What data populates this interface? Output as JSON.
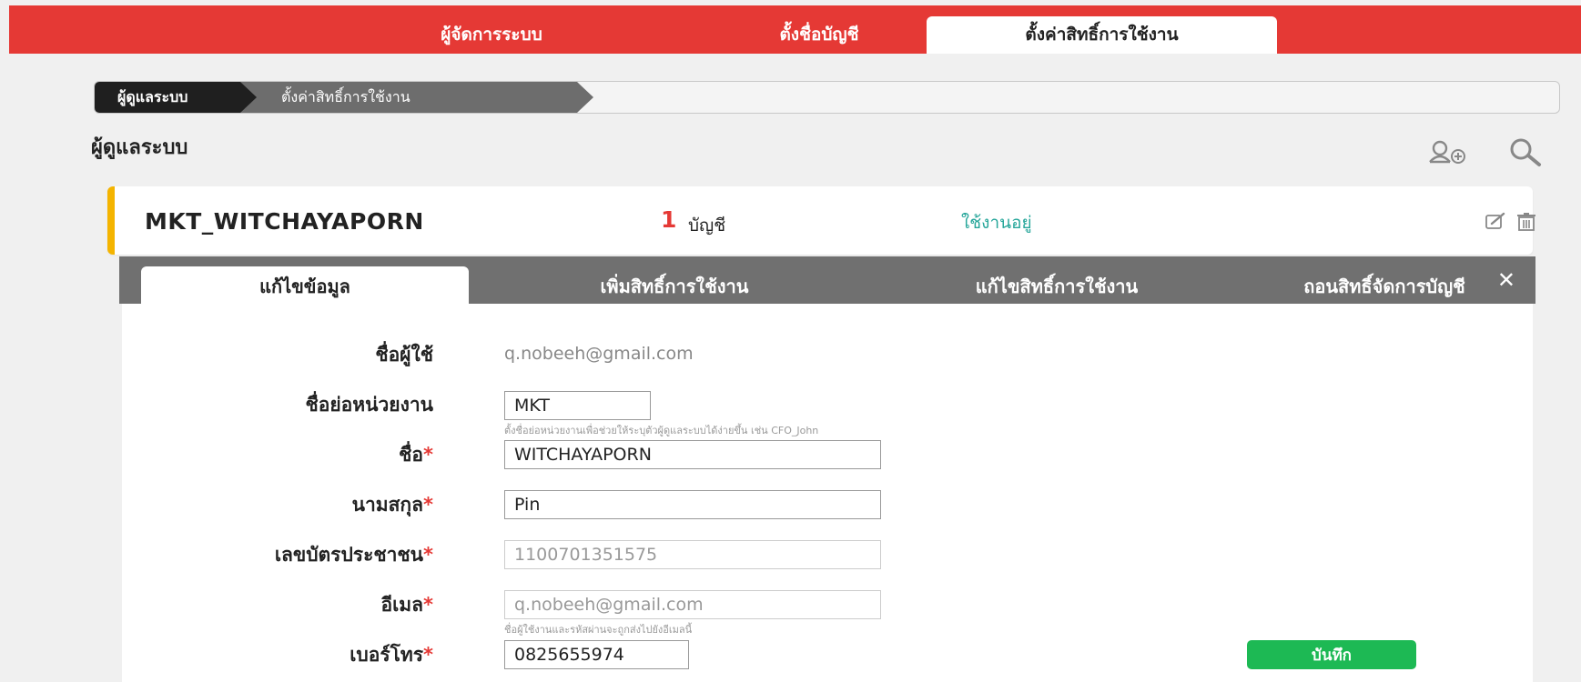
{
  "topnav": {
    "tabs": [
      {
        "label": "ผู้จัดการระบบ"
      },
      {
        "label": "ตั้งชื่อบัญชี"
      },
      {
        "label": "ตั้งค่าสิทธิ์การใช้งาน"
      }
    ],
    "active_index": 2
  },
  "breadcrumb": {
    "items": [
      "ผู้ดูแลระบบ",
      "ตั้งค่าสิทธิ์การใช้งาน"
    ]
  },
  "page": {
    "title": "ผู้ดูแลระบบ"
  },
  "icons": {
    "add_user": "add-user-icon",
    "search": "search-icon",
    "edit": "edit-icon",
    "delete": "trash-icon",
    "close": "close-icon"
  },
  "user_card": {
    "name": "MKT_WITCHAYAPORN",
    "account_count": "1",
    "account_label": "บัญชี",
    "status": "ใช้งานอยู่"
  },
  "panel": {
    "tabs": [
      {
        "label": "แก้ไขข้อมูล"
      },
      {
        "label": "เพิ่มสิทธิ์การใช้งาน"
      },
      {
        "label": "แก้ไขสิทธิ์การใช้งาน"
      },
      {
        "label": "ถอนสิทธิ์จัดการบัญชี"
      }
    ],
    "active_index": 0,
    "close_label": "✕"
  },
  "form": {
    "username_label": "ชื่อผู้ใช้",
    "username_value": "q.nobeeh@gmail.com",
    "unit_label": "ชื่อย่อหน่วยงาน",
    "unit_value": "MKT",
    "unit_hint": "ตั้งชื่อย่อหน่วยงานเพื่อช่วยให้ระบุตัวผู้ดูแลระบบได้ง่ายขึ้น เช่น CFO_John",
    "first_name_label": "ชื่อ",
    "first_name_value": "WITCHAYAPORN",
    "last_name_label": "นามสกุล",
    "last_name_value": "Pin",
    "id_label": "เลขบัตรประชาชน",
    "id_value": "1100701351575",
    "email_label": "อีเมล",
    "email_value": "q.nobeeh@gmail.com",
    "email_hint": "ชื่อผู้ใช้งานและรหัสผ่านจะถูกส่งไปยังอีเมลนี้",
    "phone_label": "เบอร์โทร",
    "phone_value": "0825655974",
    "required_mark": "*",
    "save_label": "บันทึก"
  },
  "colors": {
    "brand_red": "#e53935",
    "status_green": "#26a69a",
    "save_green": "#1db954",
    "card_accent": "#f4b400"
  }
}
